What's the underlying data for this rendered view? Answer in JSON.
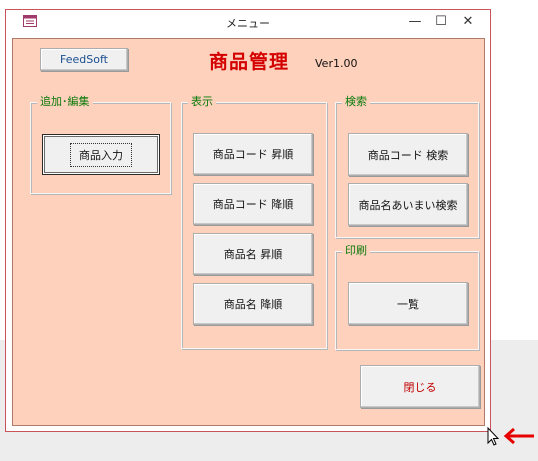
{
  "window": {
    "title": "メニュー",
    "controls": {
      "minimize": "—",
      "maximize": "☐",
      "close": "✕"
    }
  },
  "header": {
    "feed_button": "FeedSoft",
    "title": "商品管理",
    "version": "Ver1.00"
  },
  "groups": {
    "add_edit": {
      "legend": "追加･編集",
      "buttons": [
        "商品入力"
      ]
    },
    "display": {
      "legend": "表示",
      "buttons": [
        "商品コード 昇順",
        "商品コード 降順",
        "商品名 昇順",
        "商品名 降順"
      ]
    },
    "search": {
      "legend": "検索",
      "buttons": [
        "商品コード 検索",
        "商品名あいまい検索"
      ]
    },
    "print": {
      "legend": "印刷",
      "buttons": [
        "一覧"
      ]
    }
  },
  "footer": {
    "close_button": "閉じる"
  },
  "colors": {
    "form_background": "#fed1bc",
    "title_red": "#d40000",
    "legend_green": "#0a7a0a",
    "arrow_red": "#e60000",
    "window_border": "#c9545c"
  },
  "icons": {
    "app": "access-form-icon",
    "pointer": "mouse-pointer-icon",
    "annotation": "left-arrow-icon"
  }
}
